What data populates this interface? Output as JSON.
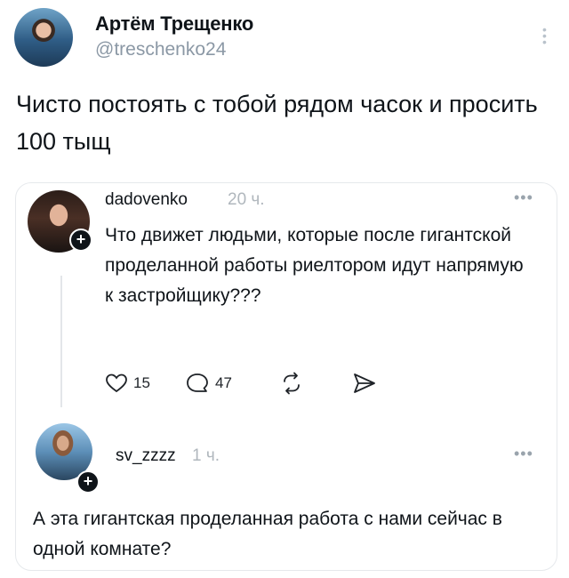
{
  "post": {
    "author_name": "Артём Трещенко",
    "author_handle": "@treschenko24",
    "text": "Чисто постоять с тобой рядом часок и просить 100 тыщ"
  },
  "replies": [
    {
      "username": "dadovenko",
      "time": "20 ч.",
      "text": "Что движет людьми, которые после гигантской проделанной работы риелтором идут напрямую к застройщику???",
      "likes": "15",
      "comments": "47"
    },
    {
      "username": "sv_zzzz",
      "time": "1 ч.",
      "text": "А эта гигантская проделанная работа с нами сейчас в одной комнате?"
    }
  ],
  "icons": {
    "like": "heart-icon",
    "comment": "comment-icon",
    "repost": "repost-icon",
    "share": "send-icon",
    "more": "more-icon",
    "follow": "plus-icon"
  },
  "colors": {
    "text": "#0f1419",
    "muted": "#8b98a5",
    "border": "#e6e9ec"
  }
}
